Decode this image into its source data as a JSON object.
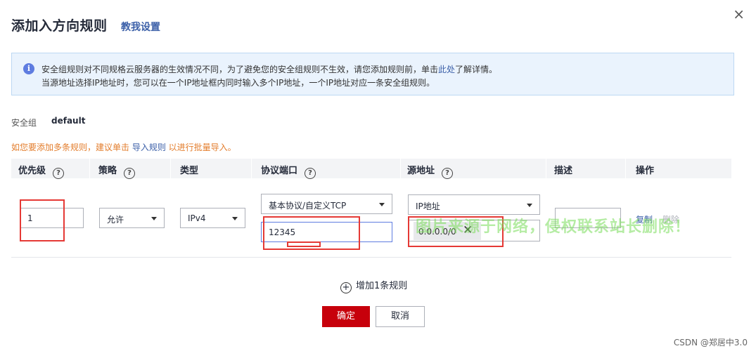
{
  "dialog": {
    "title": "添加入方向规则",
    "help_link": "教我设置",
    "close_icon": "×"
  },
  "info": {
    "line1_pre": "安全组规则对不同规格云服务器的生效情况不同，为了避免您的安全组规则不生效，请您添加规则前，单击",
    "line1_link": "此处",
    "line1_post": "了解详情。",
    "line2": "当源地址选择IP地址时，您可以在一个IP地址框内同时输入多个IP地址，一个IP地址对应一条安全组规则。"
  },
  "security_group": {
    "label": "安全组",
    "value": "default"
  },
  "hint": {
    "pre": "如您要添加多条规则，建议单击 ",
    "link": "导入规则",
    "post": " 以进行批量导入。"
  },
  "table": {
    "headers": {
      "priority": "优先级",
      "policy": "策略",
      "type": "类型",
      "protocol_port": "协议端口",
      "source": "源地址",
      "description": "描述",
      "action": "操作"
    },
    "row": {
      "priority": "1",
      "policy": "允许",
      "type": "IPv4",
      "protocol": "基本协议/自定义TCP",
      "port": "12345",
      "source_type": "IP地址",
      "source_ip": "0.0.0.0/0",
      "description": "",
      "copy": "复制",
      "delete": "删除"
    }
  },
  "add_rule": "增加1条规则",
  "buttons": {
    "ok": "确定",
    "cancel": "取消"
  },
  "watermark": "图片来源于网络，侵权联系站长删除！",
  "credit": "CSDN @郑居中3.0",
  "colors": {
    "primary": "#c7000b",
    "link": "#3b5fa8",
    "hint": "#e37d2c",
    "annotation": "#e53935"
  }
}
